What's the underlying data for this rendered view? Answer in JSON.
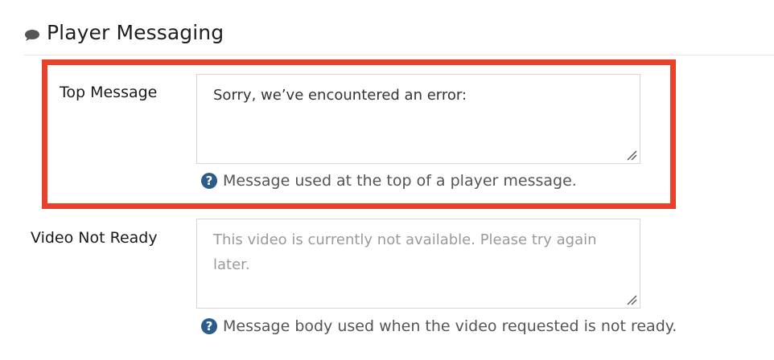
{
  "section": {
    "title": "Player Messaging",
    "icon": "speech-bubble-icon"
  },
  "fields": {
    "top_message": {
      "label": "Top Message",
      "value": "Sorry, we’ve encountered an error:",
      "placeholder": "",
      "help": "Message used at the top of a player message.",
      "help_icon": "question-circle-icon"
    },
    "video_not_ready": {
      "label": "Video Not Ready",
      "value": "",
      "placeholder": "This video is currently not available. Please try again later.",
      "help": "Message body used when the video requested is not ready.",
      "help_icon": "question-circle-icon"
    }
  },
  "colors": {
    "highlight_border": "#e8402a",
    "help_icon_bg": "#2c5d8a",
    "divider": "#e5e5e5"
  }
}
